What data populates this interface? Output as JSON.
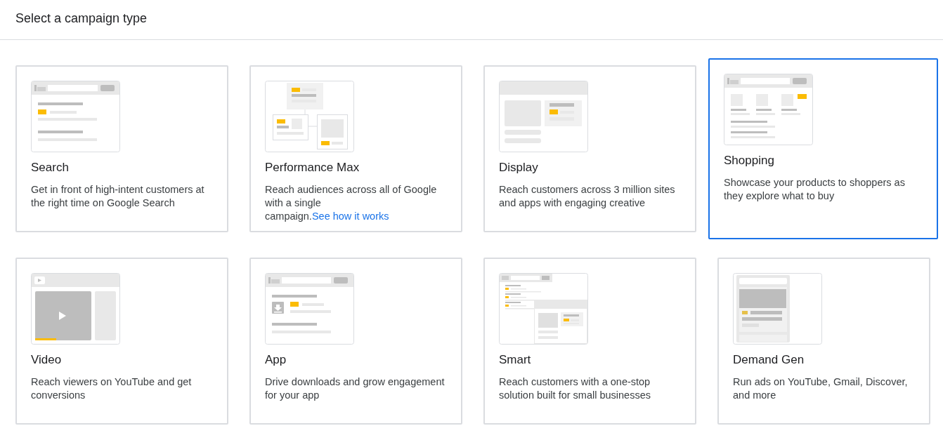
{
  "header": {
    "title": "Select a campaign type"
  },
  "campaign_types": [
    {
      "kind": "search",
      "title": "Search",
      "description": "Get in front of high-intent customers at the right time on Google Search",
      "selected": false
    },
    {
      "kind": "pmax",
      "title": "Performance Max",
      "description": "Reach audiences across all of Google with a single campaign.",
      "link": "See how it works",
      "selected": false
    },
    {
      "kind": "display",
      "title": "Display",
      "description": "Reach customers across 3 million sites and apps with engaging creative",
      "selected": false
    },
    {
      "kind": "shopping",
      "title": "Shopping",
      "description": "Showcase your products to shoppers as they explore what to buy",
      "selected": true
    },
    {
      "kind": "video",
      "title": "Video",
      "description": "Reach viewers on YouTube and get conversions",
      "selected": false
    },
    {
      "kind": "app",
      "title": "App",
      "description": "Drive downloads and grow engagement for your app",
      "selected": false
    },
    {
      "kind": "smart",
      "title": "Smart",
      "description": "Reach customers with a one-stop solution built for small businesses",
      "selected": false
    },
    {
      "kind": "demand_gen",
      "title": "Demand Gen",
      "description": "Run ads on YouTube, Gmail, Discover, and more",
      "selected": false
    }
  ]
}
